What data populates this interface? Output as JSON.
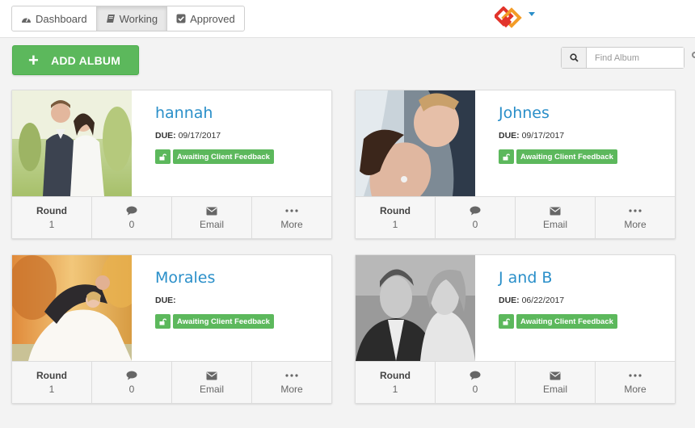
{
  "nav": {
    "tabs": [
      {
        "label": "Dashboard",
        "icon": "dashboard-gauge-icon"
      },
      {
        "label": "Working",
        "icon": "book-icon",
        "active": true
      },
      {
        "label": "Approved",
        "icon": "check-square-icon"
      }
    ]
  },
  "toolbar": {
    "add_album_label": "ADD ALBUM",
    "search_placeholder": "Find Album"
  },
  "colors": {
    "accent": "#2a8fc9",
    "success": "#5cb85c",
    "logo_red": "#e2342b",
    "logo_orange": "#f39c27"
  },
  "albums": [
    {
      "name": "hannah",
      "due_label": "DUE:",
      "due_date": "09/17/2017",
      "status": "Awaiting Client Feedback",
      "round_label": "Round",
      "round": "1",
      "comments": "0",
      "email_label": "Email",
      "more_label": "More"
    },
    {
      "name": "Johnes",
      "due_label": "DUE:",
      "due_date": "09/17/2017",
      "status": "Awaiting Client Feedback",
      "round_label": "Round",
      "round": "1",
      "comments": "0",
      "email_label": "Email",
      "more_label": "More"
    },
    {
      "name": "Morales",
      "due_label": "DUE:",
      "due_date": "",
      "status": "Awaiting Client Feedback",
      "round_label": "Round",
      "round": "1",
      "comments": "0",
      "email_label": "Email",
      "more_label": "More"
    },
    {
      "name": "J and B",
      "due_label": "DUE:",
      "due_date": "06/22/2017",
      "status": "Awaiting Client Feedback",
      "round_label": "Round",
      "round": "1",
      "comments": "0",
      "email_label": "Email",
      "more_label": "More"
    }
  ]
}
